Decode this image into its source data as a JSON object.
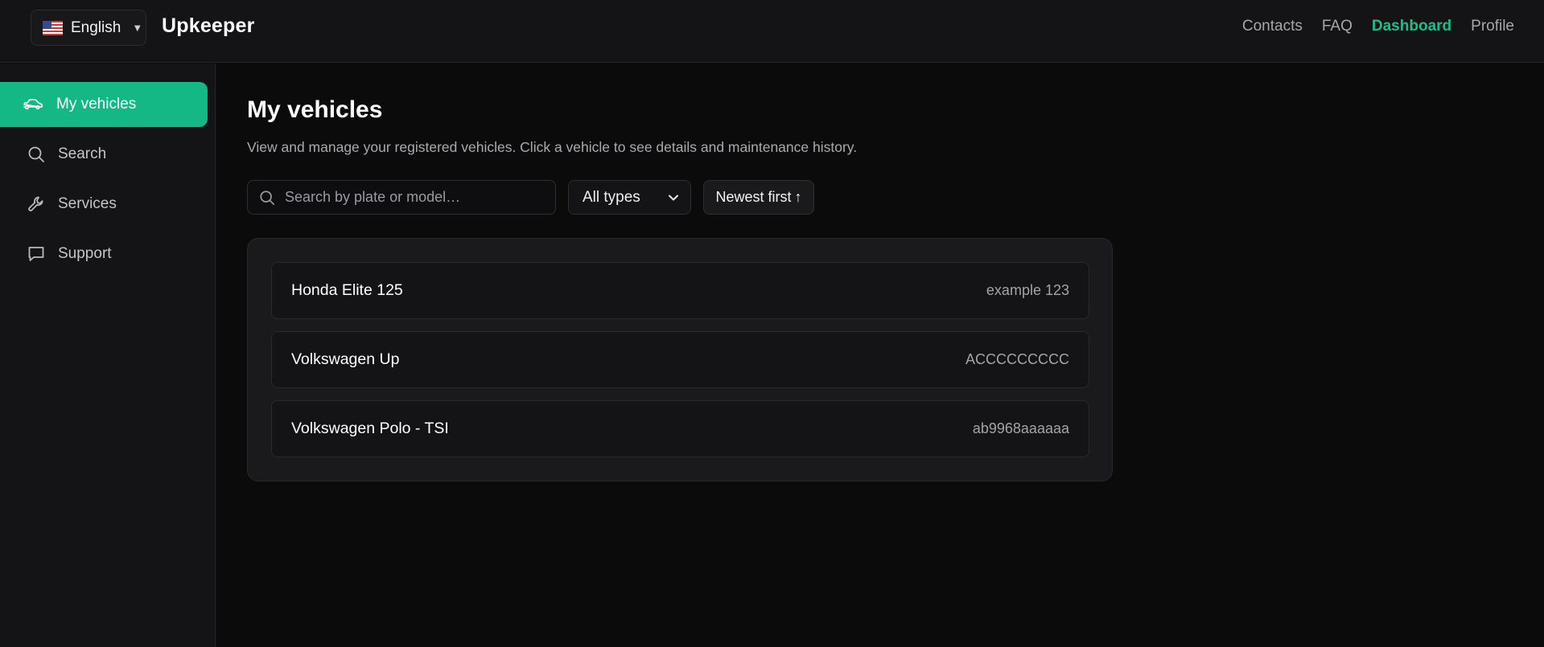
{
  "header": {
    "language": "English",
    "brand": "Upkeeper",
    "nav": [
      "Contacts",
      "FAQ",
      "Dashboard",
      "Profile"
    ],
    "active_nav": "Dashboard",
    "accent_color": "#19c08a"
  },
  "sidebar": {
    "items": [
      {
        "label": "My vehicles",
        "icon": "car-icon"
      },
      {
        "label": "Search",
        "icon": "search-icon"
      },
      {
        "label": "Services",
        "icon": "wrench-icon"
      },
      {
        "label": "Support",
        "icon": "chat-icon"
      }
    ],
    "active": "My vehicles",
    "active_color": "#13b885"
  },
  "main": {
    "title": "My vehicles",
    "subtitle": "View and manage your registered vehicles. Click a vehicle to see details and maintenance history.",
    "search_placeholder": "Search by plate or model…",
    "type_filter": "All types",
    "sort_label": "Newest first",
    "sort_icon": "↑",
    "vehicles": [
      {
        "name": "Honda Elite 125",
        "plate": "example 123"
      },
      {
        "name": "Volkswagen Up",
        "plate": "ACCCCCCCCC"
      },
      {
        "name": "Volkswagen Polo - TSI",
        "plate": "ab9968aaaaaa"
      }
    ]
  }
}
